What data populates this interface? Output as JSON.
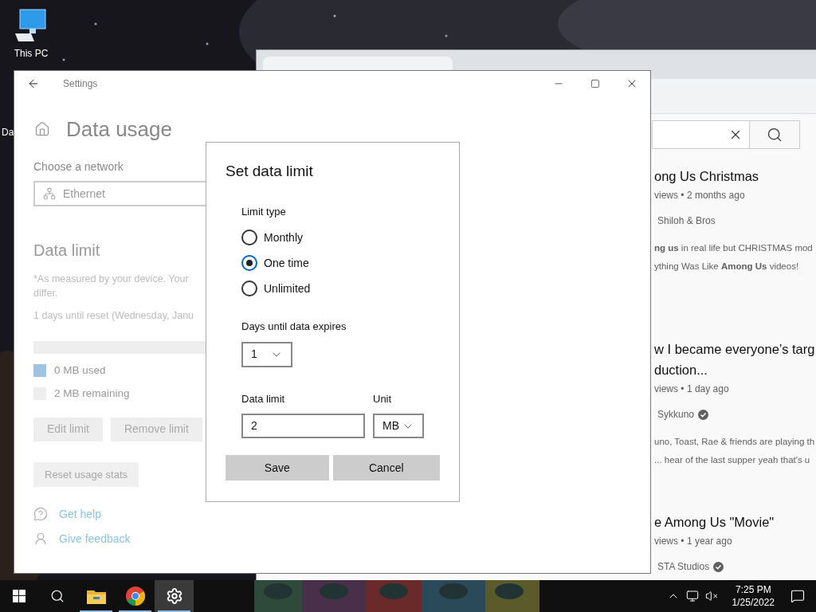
{
  "desktop": {
    "icons": [
      {
        "kind": "pc",
        "label": "This PC"
      },
      {
        "kind": "partial",
        "label": "Da"
      }
    ]
  },
  "browser": {
    "results": [
      {
        "title_lines": [
          "ong Us Christmas"
        ],
        "meta": "views • 2 months ago",
        "channel": "Shiloh & Bros",
        "verified": false,
        "description": [
          "**ng us** in real life but CHRISTMAS mod",
          "ything Was Like **Among Us** videos!"
        ]
      },
      {
        "title_lines": [
          "w I became everyone’s targ",
          "duction..."
        ],
        "meta": "views • 1 day ago",
        "channel": "Sykkuno",
        "verified": true,
        "description": [
          "uno, Toast, Rae & friends are playing th",
          "... hear of the last supper yeah that's u"
        ]
      },
      {
        "title_lines": [
          "e Among Us \"Movie\""
        ],
        "meta": "views • 1 year ago",
        "channel": "STA Studios",
        "verified": true
      }
    ]
  },
  "settings": {
    "title": "Settings",
    "heading": "Data usage",
    "network_label": "Choose a network",
    "network": "Ethernet",
    "section": "Data limit",
    "note_lines": [
      "*As measured by your device. Your",
      "differ."
    ],
    "reset_text": "1 days until reset (Wednesday, Janu",
    "usage": {
      "level": 0
    },
    "legend": [
      {
        "label": "0 MB used",
        "color": "#9fc3e3"
      },
      {
        "label": "2 MB remaining",
        "color": "#eeeeee"
      }
    ],
    "buttons": [
      "Edit limit",
      "Remove limit"
    ],
    "reset_button": "Reset usage stats",
    "links": [
      {
        "kind": "help",
        "label": "Get help"
      },
      {
        "kind": "feedback",
        "label": "Give feedback"
      }
    ]
  },
  "dialog": {
    "title": "Set data limit",
    "limit_type_label": "Limit type",
    "limit_types": [
      {
        "label": "Monthly",
        "selected": false
      },
      {
        "label": "One time",
        "selected": true
      },
      {
        "label": "Unlimited",
        "selected": false
      }
    ],
    "days_label": "Days until data expires",
    "days": "1",
    "limit_label": "Data limit",
    "limit": "2",
    "unit_label": "Unit",
    "unit": "MB",
    "buttons": [
      "Save",
      "Cancel"
    ]
  },
  "taskbar": {
    "apps": [
      {
        "kind": "explorer",
        "running": true,
        "selected": false
      },
      {
        "kind": "chrome",
        "running": true,
        "selected": false
      },
      {
        "kind": "settings",
        "running": true,
        "selected": true
      }
    ],
    "time": "7:25 PM",
    "date": "1/25/2022"
  }
}
